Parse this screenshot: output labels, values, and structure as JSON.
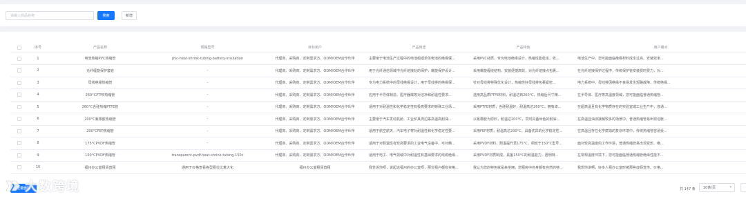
{
  "toolbar": {
    "search_placeholder": "请输入商品名称",
    "search_label": "搜索",
    "add_label": "新增"
  },
  "table": {
    "headers": [
      "序号",
      "产品名称",
      "规格型号",
      "目标用户",
      "产品用途",
      "产品特色",
      "用户痛点"
    ],
    "rows": [
      {
        "no": "1",
        "name": "电池热缩PVC热缩管",
        "spec": "pvc-heat-shrink-tubing-battery-insulation",
        "users": "代理商、采购商、定制需求方、ODM/OEM合作伙伴",
        "usage": "主要用于电池生产过程中的电池组或单体电池的绝缘保...",
        "feature": "采用PVC材质，专为电池绝缘设计，热缩性能稳定，收...",
        "pain": "电池生产中，您可能面临绝缘材料成本过高、安装效率..."
      },
      {
        "no": "2",
        "name": "光纤缠旋保护套管",
        "spec": "-",
        "users": "代理商、采购商、定制需求方、ODM/OEM合作伙伴",
        "usage": "用于光纤通信领域中光纤熔接处的保护，螺旋保护设计...",
        "feature": "采用螺旋缠绕结构，安装便捷高效，对光纤熔接点包裹...",
        "pain": "在光纤熔接保护过程中，传统保护管安装费时费力，对..."
      },
      {
        "no": "3",
        "name": "母线绝缘热缩管",
        "spec": "-",
        "users": "代理商、采购商、定制需求方、ODM/OEM合作伙伴",
        "usage": "专为电力系统中的母线绝缘设计，用于母线排的绝缘保...",
        "feature": "针对母线排特殊优化设计，热缩性好母线排包裹紧密...",
        "pain": "电力系统中，母线排因绝缘不良易发生短路故障，传统绝缘..."
      },
      {
        "no": "4",
        "name": "260°CPTFE热缩管",
        "spec": "-",
        "users": "代理商、采购商、定制需求方、ODM/OEM合作伙伴",
        "usage": "应用于半导体制造、医疗器械等对洁净和耐温性要求...",
        "feature": "选用高品质PTFE材料，耐温达到260°C，热缩后尺寸精...",
        "pain": "在半导体、医疗等高温度领域，您可能面临普通热缩管..."
      },
      {
        "no": "5",
        "name": "260°C含硅热缩PTFE管",
        "spec": "-",
        "users": "代理商、采购商、定制需求方、ODM/OEM合作伙伴",
        "usage": "适用于对耐温性和化学稳定性有极高要求的特殊工业场...",
        "feature": "采用PTFE材质，含硅耐温好，耐温高达260°C，拥有卓...",
        "pain": "在超高温且有化学物质存在的实验室或工业生产中，普通..."
      },
      {
        "no": "6",
        "name": "200°C氟橡胶热缩管",
        "spec": "-",
        "users": "代理商、采购商、定制需求方、ODM/OEM合作伙伴",
        "usage": "主要用于汽车发动机舱、工业炉具周边等高温高耐油...",
        "feature": "以氟橡胶为原料，耐温达200°C，同时具备出色的耐油...",
        "pain": "在高温且油液接触较多的场景中，普通热缩管易出现溶胀..."
      },
      {
        "no": "7",
        "name": "200°CFEP热缩管",
        "spec": "-",
        "users": "代理商、采购商、定制需求方、ODM/OEM合作伙伴",
        "usage": "适用于航空航天、汽车电子等对耐温性和化学稳定性要...",
        "feature": "采用FEP材质，耐温高达200°C，具备优异的化学稳定性...",
        "pain": "在高温且存在化学腐蚀的复杂环境中，传统热缩管容易受..."
      },
      {
        "no": "8",
        "name": "175°CPVDF热缩管",
        "spec": "-",
        "users": "代理商、采购商、定制需求方、ODM/OEM合作伙伴",
        "usage": "适用于对耐温性有较高要求的工业电气设备中，可对精...",
        "feature": "采用PVDF材料，耐温提升至175°C，相较于150°C型号...",
        "pain": "面对较高温度的工作环境，普通热缩管易出现变形、绝..."
      },
      {
        "no": "9",
        "name": "150°CPVDF热缩管",
        "spec": "transparent-pvdf-heat-shrink-tubing-150c",
        "users": "代理商、采购商、定制需求方、ODM/OEM合作伙伴",
        "usage": "适用于电子、电气领域中对耐温性有基础要求的线缆绝缘...",
        "feature": "采用PVDF材质制成，具备150°C的耐温能力，透明特...",
        "pain": "在常规温度环境下，您可能面临普通热缩管绝缘性能不..."
      },
      {
        "no": "10",
        "name": "福州办公室租赁直租",
        "spec": "通用于价格查看各型租位比着大化",
        "users": "福州办公室租赁直租",
        "usage": "我告诉你呀，说起这福州的办公室呀，那位租户都有资格...",
        "feature": "我认为您的特色就是来坐拥，您租房中自身都有自然的特...",
        "pain": "我想你讲啊，好多人租办公室时被那些虚假宣传、价格..."
      }
    ]
  },
  "footer": {
    "delete_label": "批量删除",
    "total": "共 147 条",
    "page_size": "10条/页"
  },
  "watermark": {
    "text": "大数跨境"
  }
}
